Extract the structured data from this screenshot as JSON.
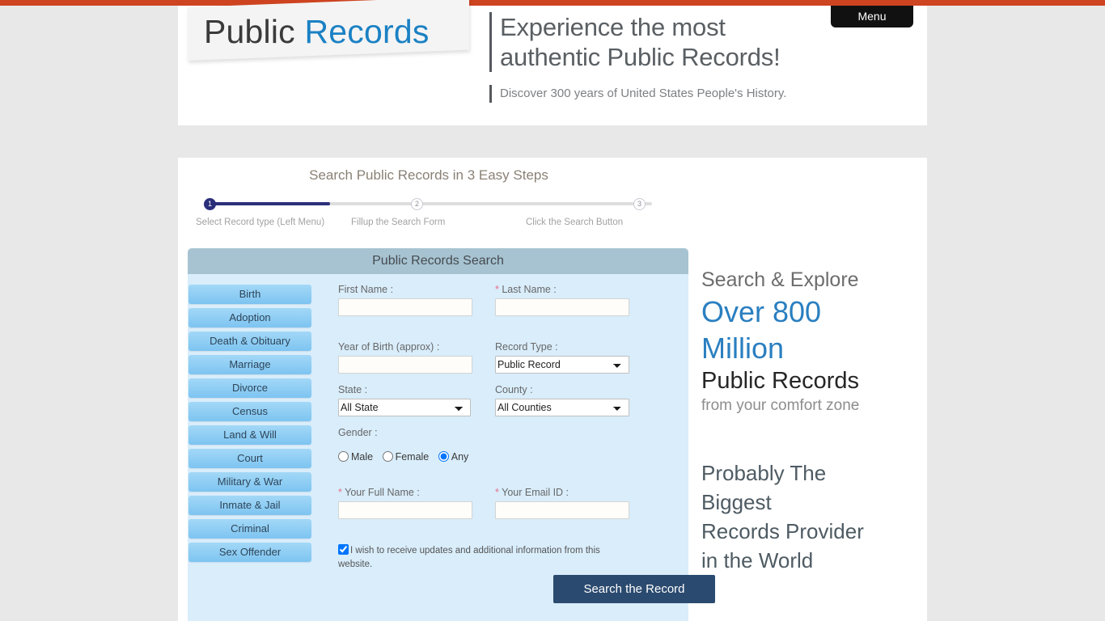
{
  "colors": {
    "top_bar": "#ce4420",
    "accent_blue": "#1b81c4",
    "promo_blue": "#2a7fc0",
    "panel_header": "#a7c3d1",
    "form_bg": "#d9edfb",
    "submit_bg": "#2b4a6f",
    "progress_fill": "#2b2f7a",
    "page_bg": "#e8e8e8",
    "required_star": "#e8708a"
  },
  "header": {
    "logo_first": "Public ",
    "logo_accent": "Records",
    "headline_line1": "Experience the most",
    "headline_line2": "authentic Public Records!",
    "subtitle": "Discover 300 years of United States People's History.",
    "menu_label": "Menu"
  },
  "steps": {
    "title_plain": "Search Public Records in ",
    "title_accent": "3 Easy Steps",
    "title_full": "Search Public Records in 3 Easy Steps",
    "items": [
      {
        "number": "1",
        "label": "Select Record type (Left Menu)",
        "active": true
      },
      {
        "number": "2",
        "label": "Fillup the Search Form",
        "active": false
      },
      {
        "number": "3",
        "label": "Click the Search Button",
        "active": false
      }
    ]
  },
  "search_panel": {
    "title": "Public Records Search"
  },
  "record_menu": {
    "items": [
      {
        "label": "Birth"
      },
      {
        "label": "Adoption"
      },
      {
        "label": "Death & Obituary"
      },
      {
        "label": "Marriage"
      },
      {
        "label": "Divorce"
      },
      {
        "label": "Census"
      },
      {
        "label": "Land & Will"
      },
      {
        "label": "Court"
      },
      {
        "label": "Military & War"
      },
      {
        "label": "Inmate & Jail"
      },
      {
        "label": "Criminal"
      },
      {
        "label": "Sex Offender"
      }
    ]
  },
  "form": {
    "first_name": {
      "label": "First Name :",
      "value": "",
      "placeholder": "",
      "required": false
    },
    "last_name": {
      "label": "Last Name :",
      "star": "*",
      "value": "",
      "placeholder": "",
      "required": true
    },
    "year_of_birth": {
      "label": "Year of Birth (approx) :",
      "value": "",
      "placeholder": ""
    },
    "record_type": {
      "label": "Record Type :",
      "selected": "Public Record",
      "options": [
        "Public Record"
      ]
    },
    "state": {
      "label": "State :",
      "selected": "All State",
      "options": [
        "All State"
      ]
    },
    "county": {
      "label": "County :",
      "selected": "All Counties",
      "options": [
        "All Counties"
      ]
    },
    "gender": {
      "label": "Gender :",
      "options": [
        {
          "label": "Male",
          "checked": false
        },
        {
          "label": "Female",
          "checked": false
        },
        {
          "label": "Any",
          "checked": true
        }
      ]
    },
    "full_name": {
      "label": "Your Full Name :",
      "star": "*",
      "value": "",
      "placeholder": "",
      "required": true
    },
    "email": {
      "label": "Your Email ID :",
      "star": "*",
      "value": "",
      "placeholder": "",
      "required": true
    },
    "updates_checkbox": {
      "label": "I wish to receive updates and additional information from this website.",
      "checked": true
    },
    "submit_label": "Search the Record"
  },
  "promo": {
    "line1": "Search & Explore",
    "line2": "Over 800",
    "line3": "Million",
    "line4": "Public Records",
    "line5": "from your comfort zone",
    "block2_line1": "Probably The",
    "block2_line2": "Biggest",
    "block2_line3": "Records Provider",
    "block2_line4": "in the World"
  }
}
